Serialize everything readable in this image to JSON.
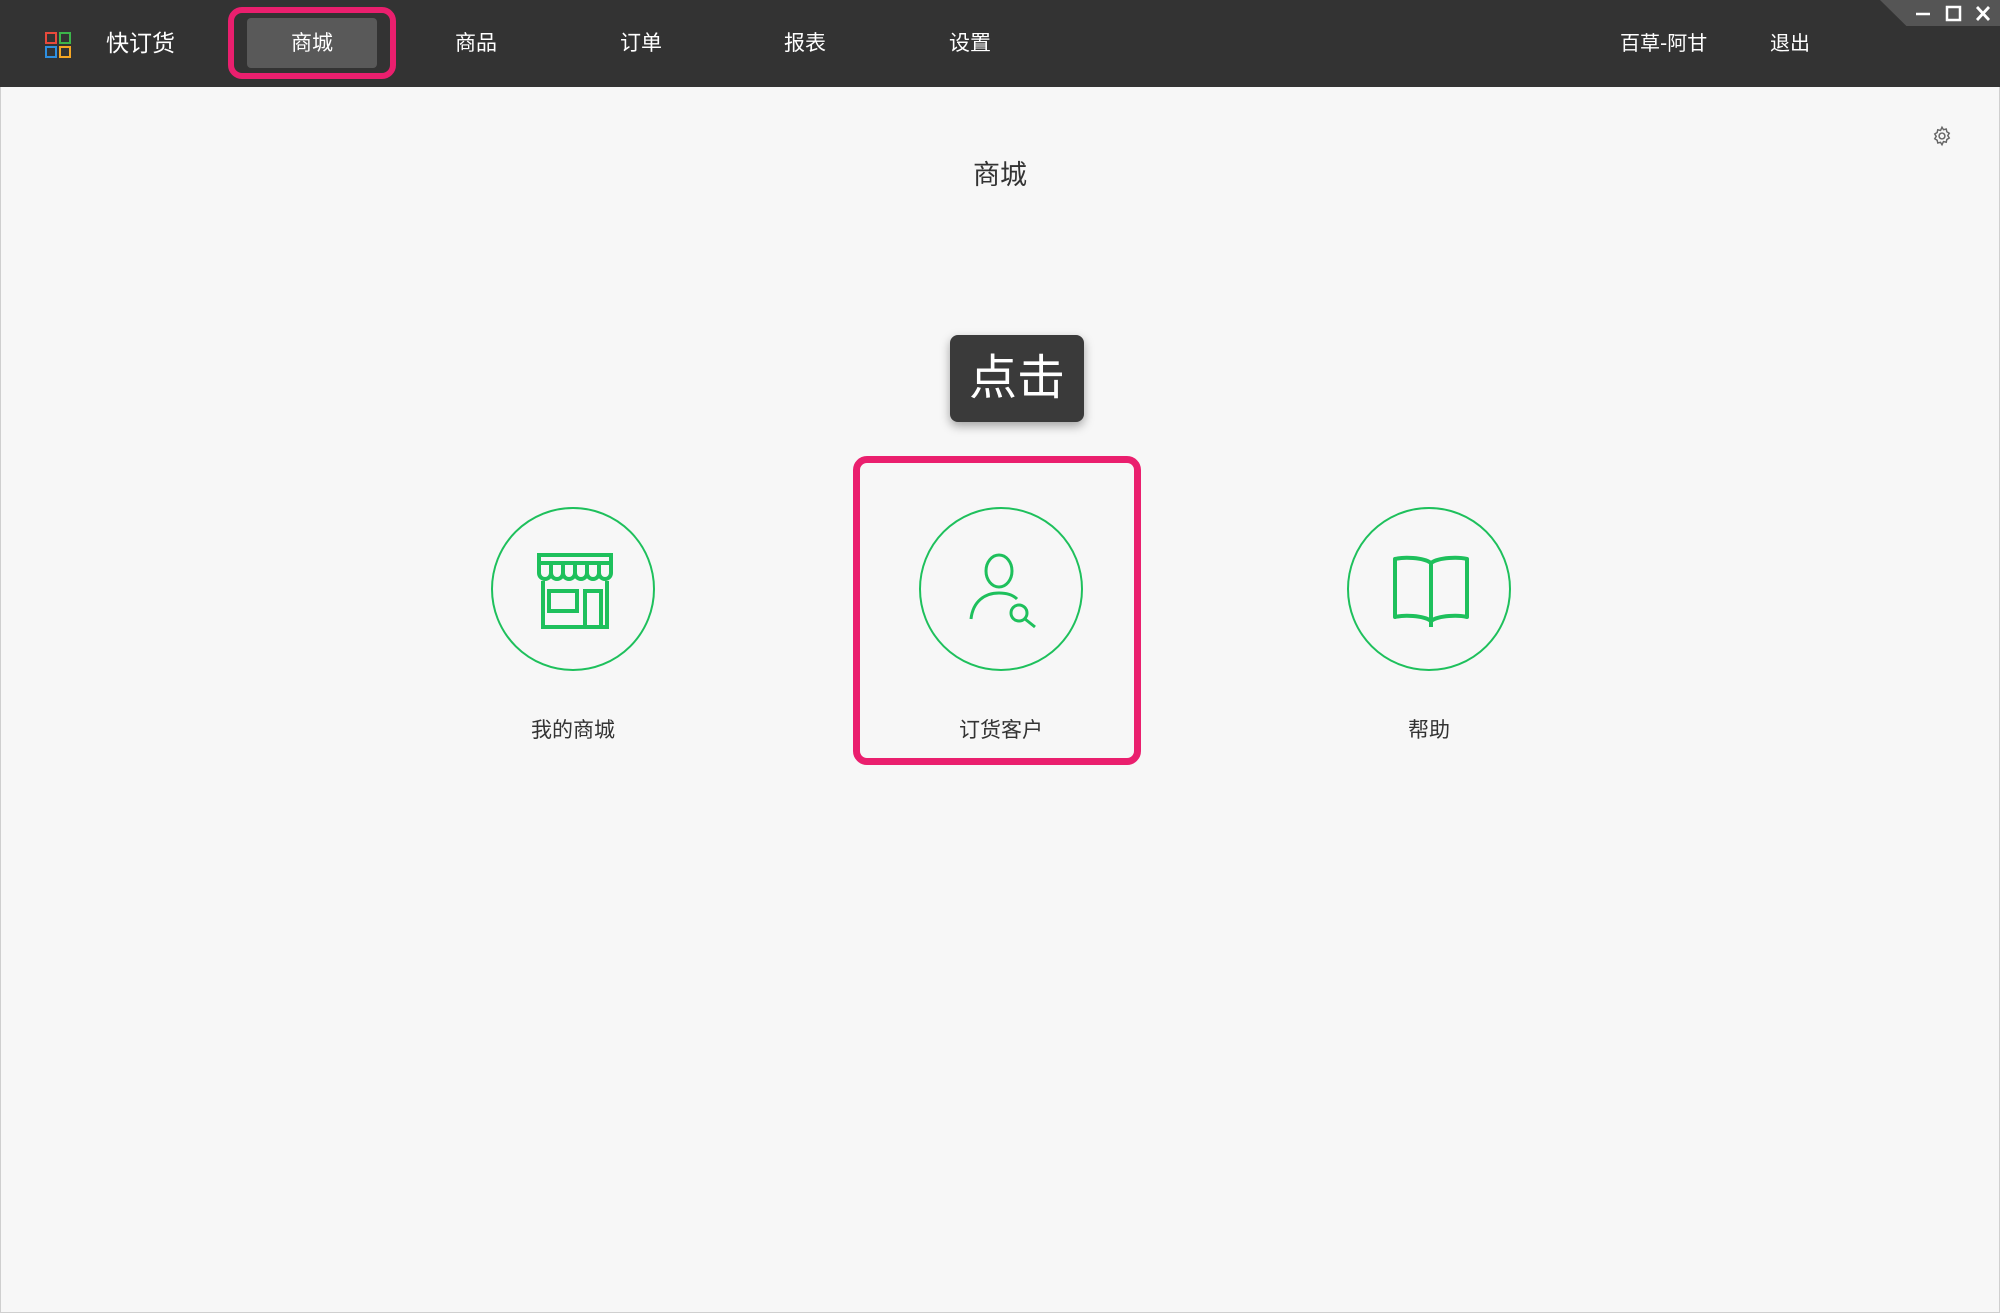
{
  "app": {
    "title": "快订货"
  },
  "nav": {
    "items": [
      {
        "label": "商城"
      },
      {
        "label": "商品"
      },
      {
        "label": "订单"
      },
      {
        "label": "报表"
      },
      {
        "label": "设置"
      }
    ],
    "active_index": 0
  },
  "user": {
    "name": "百草-阿甘",
    "logout_label": "退出"
  },
  "window_controls": [
    "minimize-icon",
    "maximize-icon",
    "close-icon"
  ],
  "page": {
    "title": "商城"
  },
  "tooltip": {
    "text": "点击"
  },
  "tiles": [
    {
      "label": "我的商城",
      "icon": "store-icon"
    },
    {
      "label": "订货客户",
      "icon": "customer-search-icon"
    },
    {
      "label": "帮助",
      "icon": "book-icon"
    }
  ],
  "colors": {
    "topbar": "#333333",
    "accent_green": "#1ec05c",
    "highlight_pink": "#ea1f6e",
    "background": "#f7f7f7"
  }
}
